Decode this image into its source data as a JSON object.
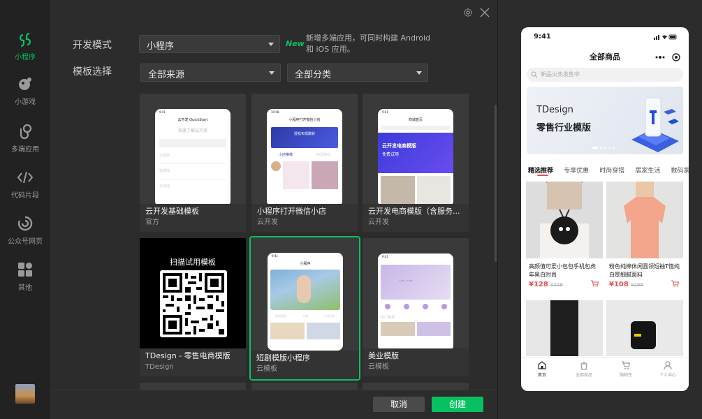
{
  "sidebar": {
    "items": [
      {
        "label": "小程序",
        "icon": "miniprogram-icon",
        "active": true
      },
      {
        "label": "小游戏",
        "icon": "minigame-icon",
        "active": false
      },
      {
        "label": "多端应用",
        "icon": "multiplatform-icon",
        "active": false
      },
      {
        "label": "代码片段",
        "icon": "code-snippet-icon",
        "active": false
      },
      {
        "label": "公众号网页",
        "icon": "official-account-icon",
        "active": false
      },
      {
        "label": "其他",
        "icon": "grid-icon",
        "active": false
      }
    ]
  },
  "form": {
    "dev_mode_label": "开发模式",
    "dev_mode_value": "小程序",
    "new_tag": "New",
    "new_desc": "新增多端应用，可同时构建 Android 和 iOS 应用。",
    "template_label": "模板选择",
    "source_value": "全部来源",
    "category_value": "全部分类"
  },
  "templates": [
    {
      "title": "云开发基础模板",
      "sub": "官方",
      "selected": false,
      "phone": {
        "time": "9:41",
        "header": "云开发 QuickStart",
        "heading": "快速了解云开发",
        "rows": [
          "云函数",
          "数据库",
          "云存储"
        ]
      }
    },
    {
      "title": "小程序打开微信小店",
      "sub": "云开发",
      "selected": false,
      "phone": {
        "time": "10:08",
        "header": "小程序打开微信小店",
        "heading": "轻松实现跳转",
        "rows": [
          "小店推荐",
          "商品推荐"
        ]
      }
    },
    {
      "title": "云开发电商模版（含服务...",
      "sub": "云开发",
      "selected": false,
      "phone": {
        "time": "9:41",
        "header": "商城首页",
        "heading": "云开发电商模版",
        "rows": [
          "免费试用"
        ]
      }
    },
    {
      "title": "TDesign - 零售电商模版",
      "sub": "TDesign",
      "selected": false,
      "qr_text": "扫描试用模板"
    },
    {
      "title": "短剧模版小程序",
      "sub": "云模板",
      "selected": true,
      "phone": {
        "time": "9:41",
        "header": "小程序",
        "heading": "",
        "rows": [
          "剧场推荐",
          "分类",
          "分享好友"
        ]
      }
    },
    {
      "title": "美业模版",
      "sub": "云模板",
      "selected": false,
      "phone": {
        "time": "9:41",
        "header": "",
        "heading": "",
        "rows": [
          "热门推荐"
        ]
      }
    }
  ],
  "actions": {
    "cancel": "取消",
    "create": "创建"
  },
  "preview": {
    "time": "9:41",
    "nav_title": "全部商品",
    "search_placeholder": "新品火热发售中",
    "banner_line1": "TDesign",
    "banner_line2": "零售行业模版",
    "tabs": [
      "精选推荐",
      "专享优惠",
      "时尚穿搭",
      "居家生活",
      "数码家电"
    ],
    "products": [
      {
        "name": "高颜值可爱小包包手机包虎年黑白时尚",
        "price": "¥128",
        "old_price": "¥229"
      },
      {
        "name": "粉色纯棉休闲圆领短袖T恤纯白厚细腻面料",
        "price": "¥108",
        "old_price": "¥299"
      }
    ],
    "tabbar": [
      "首页",
      "全部商品",
      "购物车",
      "个人中心"
    ]
  }
}
